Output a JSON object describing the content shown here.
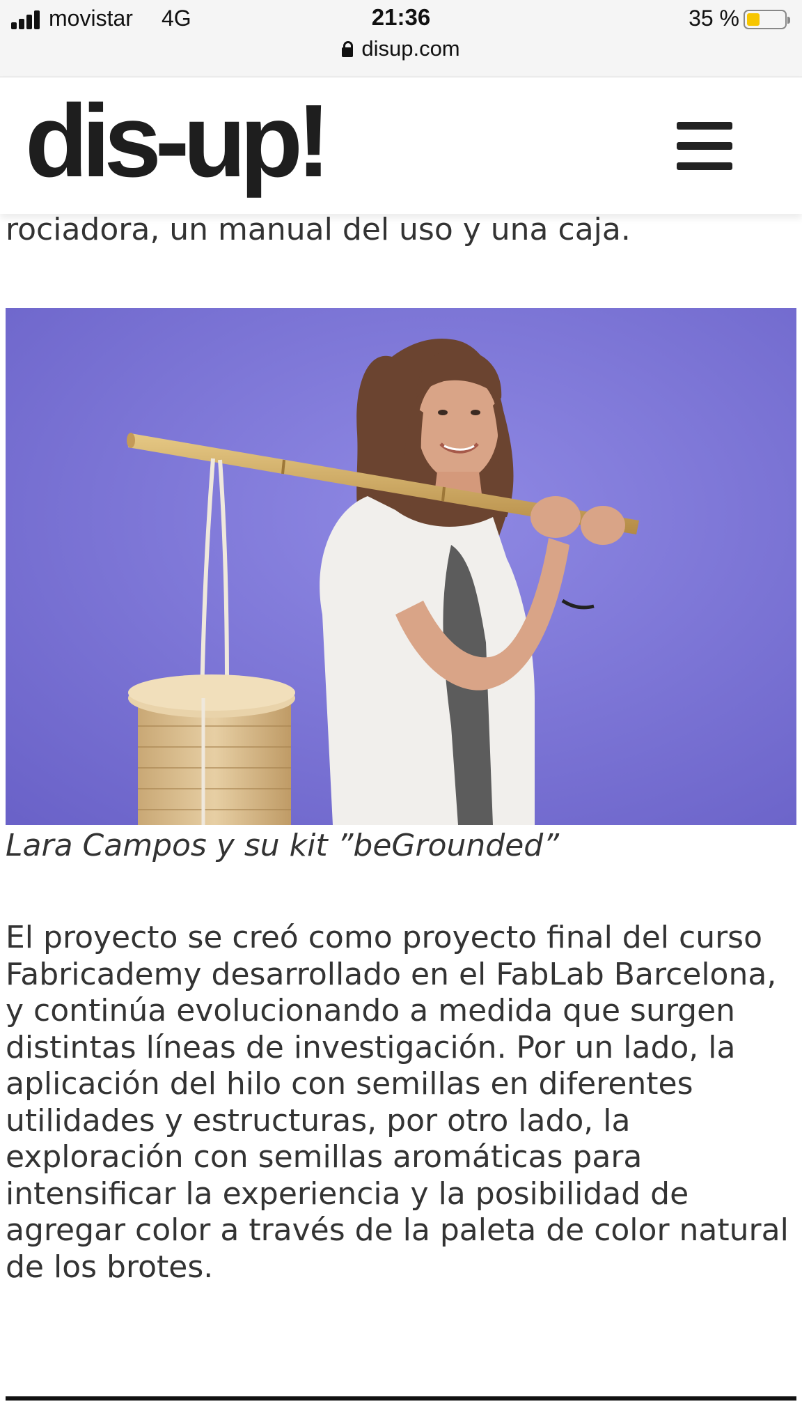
{
  "status_bar": {
    "carrier": "movistar",
    "network": "4G",
    "time": "21:36",
    "battery": "35 %",
    "battery_level": 0.35,
    "url": "disup.com"
  },
  "header": {
    "logo": "dis-up!"
  },
  "article": {
    "clipped_line": "rociadora, un manual del uso y una caja.",
    "caption": "Lara Campos y su kit ”beGrounded”",
    "paragraph": "El proyecto se creó como proyecto final del curso Fabricademy desarrollado en el FabLab Barcelona, y continúa evolucionando a medida que surgen distintas líneas de investigación. Por un lado, la aplicación del hilo con semillas en diferentes utilidades y estructuras, por otro lado, la exploración con semillas aromáticas para intensificar la experiencia y la posibilidad de agregar color a través de la paleta de color natural de los brotes."
  },
  "colors": {
    "photo_background": "#7f78d6",
    "battery_fill": "#f7c600",
    "text": "#333333"
  },
  "icons": [
    "signal-icon",
    "lock-icon",
    "battery-icon",
    "hamburger-menu-icon"
  ]
}
